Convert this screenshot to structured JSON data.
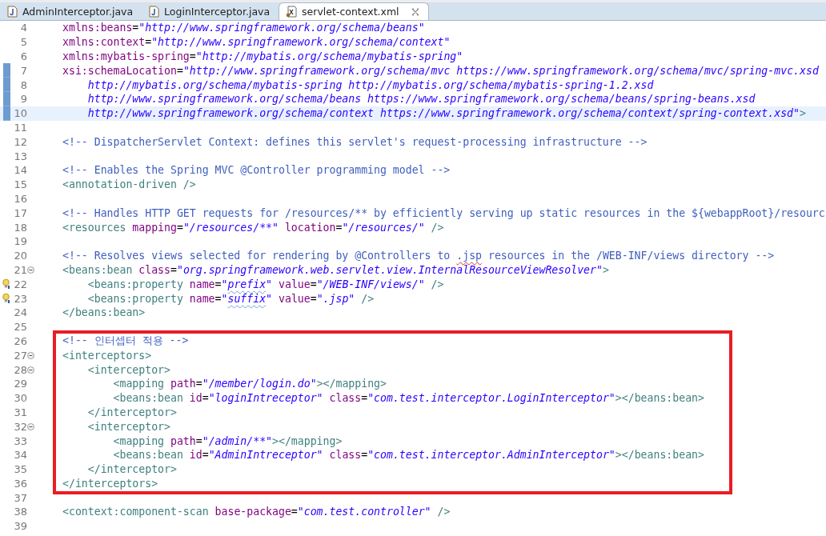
{
  "tabs": [
    {
      "label": "AdminInterceptor.java",
      "kind": "java",
      "selected": false
    },
    {
      "label": "LoginInterceptor.java",
      "kind": "java",
      "selected": false
    },
    {
      "label": "servlet-context.xml",
      "kind": "xml",
      "selected": true
    }
  ],
  "blocks": [
    {
      "kind": "plain",
      "lines": [
        {
          "number": "4",
          "current": false,
          "fold": false,
          "changed": false,
          "hint": false,
          "tokens": [
            {
              "kind": "attr",
              "text": "xmlns:beans"
            },
            {
              "kind": "plain",
              "text": "="
            },
            {
              "kind": "value",
              "text": "\"http://www.springframework.org/schema/beans\""
            }
          ]
        },
        {
          "number": "5",
          "current": false,
          "fold": false,
          "changed": false,
          "hint": false,
          "tokens": [
            {
              "kind": "attr",
              "text": "xmlns:context"
            },
            {
              "kind": "plain",
              "text": "="
            },
            {
              "kind": "value",
              "text": "\"http://www.springframework.org/schema/context\""
            }
          ]
        },
        {
          "number": "6",
          "current": false,
          "fold": false,
          "changed": false,
          "hint": false,
          "tokens": [
            {
              "kind": "attr",
              "text": "xmlns:mybatis-spring"
            },
            {
              "kind": "plain",
              "text": "="
            },
            {
              "kind": "value",
              "text": "\"http://mybatis.org/schema/mybatis-spring\""
            }
          ]
        },
        {
          "number": "7",
          "current": false,
          "fold": false,
          "changed": true,
          "hint": false,
          "tokens": [
            {
              "kind": "attr",
              "text": "xsi:schemaLocation"
            },
            {
              "kind": "plain",
              "text": "="
            },
            {
              "kind": "value",
              "text": "\"http://www.springframework.org/schema/mvc https://www.springframework.org/schema/mvc/spring-mvc.xsd"
            }
          ]
        },
        {
          "number": "8",
          "current": false,
          "fold": false,
          "changed": true,
          "hint": false,
          "tokens": [
            {
              "kind": "value",
              "text": "    http://mybatis.org/schema/mybatis-spring http://mybatis.org/schema/mybatis-spring-1.2.xsd"
            }
          ]
        },
        {
          "number": "9",
          "current": false,
          "fold": false,
          "changed": true,
          "hint": false,
          "tokens": [
            {
              "kind": "value",
              "text": "    http://www.springframework.org/schema/beans https://www.springframework.org/schema/beans/spring-beans.xsd"
            }
          ]
        },
        {
          "number": "10",
          "current": true,
          "fold": false,
          "changed": true,
          "hint": false,
          "tokens": [
            {
              "kind": "value",
              "text": "    http://www.springframework.org/schema/context https://www.springframework.org/schema/context/spring-context.xsd\""
            },
            {
              "kind": "tag",
              "text": ">"
            }
          ]
        },
        {
          "number": "11",
          "current": false,
          "fold": false,
          "changed": false,
          "hint": false
        },
        {
          "number": "12",
          "current": false,
          "fold": false,
          "changed": false,
          "hint": false,
          "tokens": [
            {
              "kind": "comment",
              "text": "<!-- DispatcherServlet Context: defines this servlet's request-processing infrastructure -->"
            }
          ]
        },
        {
          "number": "13",
          "current": false,
          "fold": false,
          "changed": false,
          "hint": false
        },
        {
          "number": "14",
          "current": false,
          "fold": false,
          "changed": false,
          "hint": false,
          "tokens": [
            {
              "kind": "comment",
              "text": "<!-- Enables the Spring MVC @Controller programming model -->"
            }
          ]
        },
        {
          "number": "15",
          "current": false,
          "fold": false,
          "changed": false,
          "hint": false,
          "tokens": [
            {
              "kind": "tag",
              "text": "<annotation-driven />"
            }
          ]
        },
        {
          "number": "16",
          "current": false,
          "fold": false,
          "changed": false,
          "hint": false
        },
        {
          "number": "17",
          "current": false,
          "fold": false,
          "changed": false,
          "hint": false,
          "tokens": [
            {
              "kind": "comment",
              "text": "<!-- Handles HTTP GET requests for /resources/** by efficiently serving up static resources in the ${webappRoot}/resourc"
            }
          ]
        },
        {
          "number": "18",
          "current": false,
          "fold": false,
          "changed": false,
          "hint": false,
          "tokens": [
            {
              "kind": "tag",
              "text": "<resources"
            },
            {
              "kind": "attr",
              "text": " mapping"
            },
            {
              "kind": "plain",
              "text": "="
            },
            {
              "kind": "value",
              "text": "\"/resources/**\""
            },
            {
              "kind": "attr",
              "text": " location"
            },
            {
              "kind": "plain",
              "text": "="
            },
            {
              "kind": "value",
              "text": "\"/resources/\""
            },
            {
              "kind": "tag",
              "text": " />"
            }
          ]
        },
        {
          "number": "19",
          "current": false,
          "fold": false,
          "changed": false,
          "hint": false
        },
        {
          "number": "20",
          "current": false,
          "fold": false,
          "changed": false,
          "hint": false,
          "tokens": [
            {
              "kind": "comment",
              "text": "<!-- Resolves views selected for rendering by @Controllers to "
            },
            {
              "kind": "misspelt",
              "text": ".jsp"
            },
            {
              "kind": "comment",
              "text": " resources in the /WEB-INF/views directory -->"
            }
          ]
        },
        {
          "number": "21",
          "current": false,
          "fold": true,
          "changed": false,
          "hint": false,
          "tokens": [
            {
              "kind": "tag",
              "text": "<beans:bean"
            },
            {
              "kind": "attr",
              "text": " class"
            },
            {
              "kind": "plain",
              "text": "="
            },
            {
              "kind": "value",
              "text": "\"org.springframework.web.servlet.view.InternalResourceViewResolver\""
            },
            {
              "kind": "tag",
              "text": ">"
            }
          ]
        },
        {
          "number": "22",
          "current": false,
          "fold": false,
          "changed": false,
          "hint": true,
          "tokens": [
            {
              "kind": "tag",
              "text": "    <beans:property"
            },
            {
              "kind": "attr",
              "text": " name"
            },
            {
              "kind": "plain",
              "text": "="
            },
            {
              "kind": "value",
              "text": "\""
            },
            {
              "kind": "flagged",
              "text": "prefix"
            },
            {
              "kind": "value",
              "text": "\""
            },
            {
              "kind": "attr",
              "text": " value"
            },
            {
              "kind": "plain",
              "text": "="
            },
            {
              "kind": "value",
              "text": "\"/WEB-INF/views/\""
            },
            {
              "kind": "tag",
              "text": " />"
            }
          ]
        },
        {
          "number": "23",
          "current": false,
          "fold": false,
          "changed": false,
          "hint": true,
          "tokens": [
            {
              "kind": "tag",
              "text": "    <beans:property"
            },
            {
              "kind": "attr",
              "text": " name"
            },
            {
              "kind": "plain",
              "text": "="
            },
            {
              "kind": "value",
              "text": "\""
            },
            {
              "kind": "flagged",
              "text": "suffix"
            },
            {
              "kind": "value",
              "text": "\""
            },
            {
              "kind": "attr",
              "text": " value"
            },
            {
              "kind": "plain",
              "text": "="
            },
            {
              "kind": "value",
              "text": "\".jsp\""
            },
            {
              "kind": "tag",
              "text": " />"
            }
          ]
        },
        {
          "number": "24",
          "current": false,
          "fold": false,
          "changed": false,
          "hint": false,
          "tokens": [
            {
              "kind": "tag",
              "text": "</beans:bean>"
            }
          ]
        },
        {
          "number": "25",
          "current": false,
          "fold": false,
          "changed": false,
          "hint": false
        }
      ]
    },
    {
      "kind": "boxed",
      "lines": [
        {
          "number": "26",
          "current": false,
          "fold": false,
          "changed": false,
          "hint": false,
          "tokens": [
            {
              "kind": "comment",
              "text": "<!-- 인터셉터 적용 -->"
            }
          ]
        },
        {
          "number": "27",
          "current": false,
          "fold": true,
          "changed": false,
          "hint": false,
          "tokens": [
            {
              "kind": "tag",
              "text": "<interceptors>"
            }
          ]
        },
        {
          "number": "28",
          "current": false,
          "fold": true,
          "changed": false,
          "hint": false,
          "tokens": [
            {
              "kind": "tag",
              "text": "    <interceptor>"
            }
          ]
        },
        {
          "number": "29",
          "current": false,
          "fold": false,
          "changed": false,
          "hint": false,
          "tokens": [
            {
              "kind": "tag",
              "text": "        <mapping"
            },
            {
              "kind": "attr",
              "text": " path"
            },
            {
              "kind": "plain",
              "text": "="
            },
            {
              "kind": "value",
              "text": "\"/member/login.do\""
            },
            {
              "kind": "tag",
              "text": "></mapping>"
            }
          ]
        },
        {
          "number": "30",
          "current": false,
          "fold": false,
          "changed": false,
          "hint": false,
          "tokens": [
            {
              "kind": "tag",
              "text": "        <beans:bean"
            },
            {
              "kind": "attr",
              "text": " id"
            },
            {
              "kind": "plain",
              "text": "="
            },
            {
              "kind": "value",
              "text": "\"loginIntreceptor\""
            },
            {
              "kind": "attr",
              "text": " class"
            },
            {
              "kind": "plain",
              "text": "="
            },
            {
              "kind": "value",
              "text": "\"com.test.interceptor.LoginInterceptor\""
            },
            {
              "kind": "tag",
              "text": "></beans:bean>"
            }
          ]
        },
        {
          "number": "31",
          "current": false,
          "fold": false,
          "changed": false,
          "hint": false,
          "tokens": [
            {
              "kind": "tag",
              "text": "    </interceptor>"
            }
          ]
        },
        {
          "number": "32",
          "current": false,
          "fold": true,
          "changed": false,
          "hint": false,
          "tokens": [
            {
              "kind": "tag",
              "text": "    <interceptor>"
            }
          ]
        },
        {
          "number": "33",
          "current": false,
          "fold": false,
          "changed": false,
          "hint": false,
          "tokens": [
            {
              "kind": "tag",
              "text": "        <mapping"
            },
            {
              "kind": "attr",
              "text": " path"
            },
            {
              "kind": "plain",
              "text": "="
            },
            {
              "kind": "value",
              "text": "\"/admin/**\""
            },
            {
              "kind": "tag",
              "text": "></mapping>"
            }
          ]
        },
        {
          "number": "34",
          "current": false,
          "fold": false,
          "changed": false,
          "hint": false,
          "tokens": [
            {
              "kind": "tag",
              "text": "        <beans:bean"
            },
            {
              "kind": "attr",
              "text": " id"
            },
            {
              "kind": "plain",
              "text": "="
            },
            {
              "kind": "value",
              "text": "\"AdminIntreceptor\""
            },
            {
              "kind": "attr",
              "text": " class"
            },
            {
              "kind": "plain",
              "text": "="
            },
            {
              "kind": "value",
              "text": "\"com.test.interceptor.AdminInterceptor\""
            },
            {
              "kind": "tag",
              "text": "></beans:bean>"
            }
          ]
        },
        {
          "number": "35",
          "current": false,
          "fold": false,
          "changed": false,
          "hint": false,
          "tokens": [
            {
              "kind": "tag",
              "text": "    </interceptor>"
            }
          ]
        },
        {
          "number": "36",
          "current": false,
          "fold": false,
          "changed": false,
          "hint": false,
          "tokens": [
            {
              "kind": "tag",
              "text": "</interceptors>"
            }
          ]
        }
      ]
    },
    {
      "kind": "plain",
      "lines": [
        {
          "number": "37",
          "current": false,
          "fold": false,
          "changed": false,
          "hint": false
        },
        {
          "number": "38",
          "current": false,
          "fold": false,
          "changed": false,
          "hint": false,
          "tokens": [
            {
              "kind": "tag",
              "text": "<context:component-scan"
            },
            {
              "kind": "attr",
              "text": " base-package"
            },
            {
              "kind": "plain",
              "text": "="
            },
            {
              "kind": "value",
              "text": "\"com.test.controller\""
            },
            {
              "kind": "tag",
              "text": " />"
            }
          ]
        },
        {
          "number": "39",
          "current": false,
          "fold": false,
          "changed": false,
          "hint": false
        }
      ]
    }
  ]
}
